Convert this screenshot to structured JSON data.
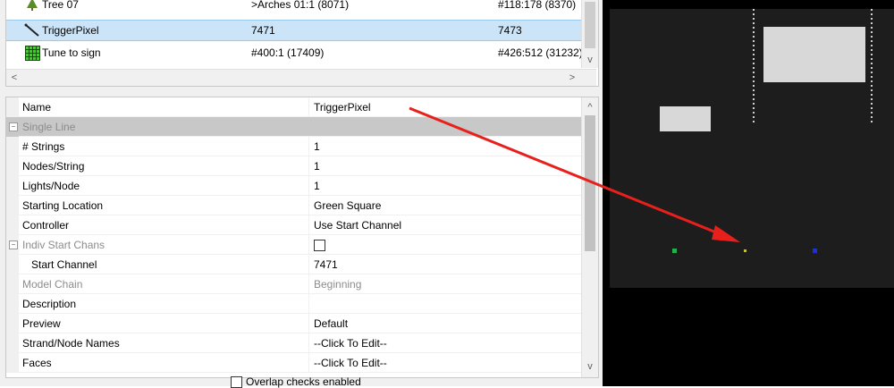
{
  "models": [
    {
      "name": "Tree 07",
      "start": ">Arches 01:1 (8071)",
      "end": "#118:178 (8370)",
      "icon": "tree-icon"
    },
    {
      "name": "TriggerPixel",
      "start": "7471",
      "end": "7473",
      "icon": "single-line-icon",
      "selected": true
    },
    {
      "name": "Tune to sign",
      "start": "#400:1 (17409)",
      "end": "#426:512 (31232)",
      "icon": "matrix-icon"
    }
  ],
  "scroll": {
    "left_arrow": "<",
    "right_arrow": ">",
    "up_arrow": "^",
    "down_arrow": "v"
  },
  "properties": [
    {
      "name": "Name",
      "value": "TriggerPixel"
    },
    {
      "name": "Single Line",
      "category": true
    },
    {
      "name": "# Strings",
      "value": "1"
    },
    {
      "name": "Nodes/String",
      "value": "1"
    },
    {
      "name": "Lights/Node",
      "value": "1"
    },
    {
      "name": "Starting Location",
      "value": "Green Square"
    },
    {
      "name": "Controller",
      "value": "Use Start Channel"
    },
    {
      "name": "Indiv Start Chans",
      "value": "",
      "checkbox": true
    },
    {
      "name": "Start Channel",
      "value": "7471"
    },
    {
      "name": "Model Chain",
      "value": "Beginning"
    },
    {
      "name": "Description",
      "value": ""
    },
    {
      "name": "Preview",
      "value": "Default"
    },
    {
      "name": "Strand/Node Names",
      "value": "--Click To Edit--"
    },
    {
      "name": "Faces",
      "value": "--Click To Edit--"
    }
  ],
  "footer": {
    "overlap_label": "Overlap checks enabled"
  },
  "colors": {
    "selection": "#cce4f7",
    "category": "#c8c8c8",
    "arrow": "#e8201c",
    "green_node": "#22b14c",
    "yellow_node": "#d6c400",
    "blue_node": "#1c2fd8"
  }
}
